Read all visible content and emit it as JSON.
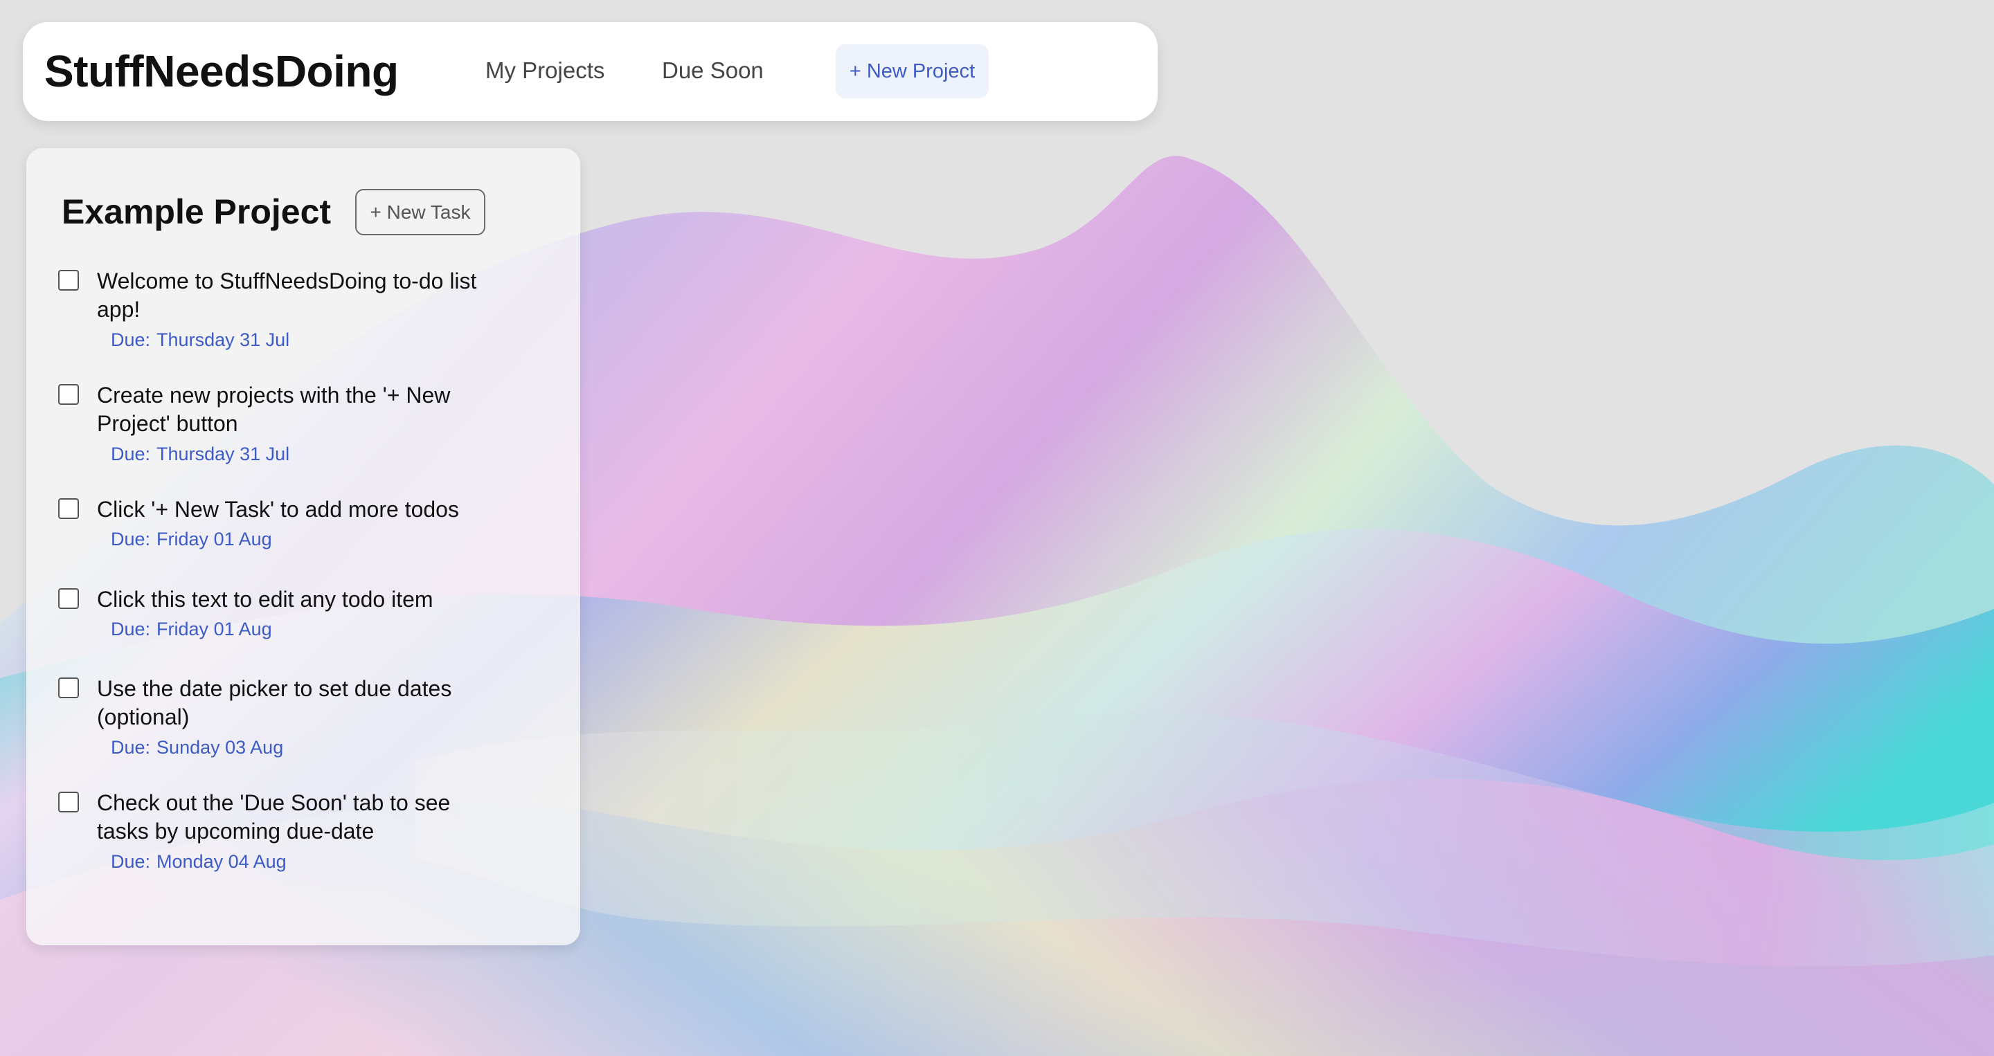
{
  "app": {
    "title": "StuffNeedsDoing"
  },
  "nav": {
    "my_projects": "My Projects",
    "due_soon": "Due Soon",
    "new_project": "+ New Project"
  },
  "project": {
    "title": "Example Project",
    "new_task": "+ New Task",
    "due_label": "Due:",
    "tasks": [
      {
        "text": "Welcome to StuffNeedsDoing to-do list app!",
        "due": "Thursday 31 Jul",
        "checked": false
      },
      {
        "text": "Create new projects with the '+ New Project' button",
        "due": "Thursday 31 Jul",
        "checked": false
      },
      {
        "text": "Click '+ New Task' to add more todos",
        "due": "Friday 01 Aug",
        "checked": false
      },
      {
        "text": "Click this text to edit any todo item",
        "due": "Friday 01 Aug",
        "checked": false
      },
      {
        "text": "Use the date picker to set due dates (optional)",
        "due": "Sunday 03 Aug",
        "checked": false
      },
      {
        "text": "Check out the 'Due Soon' tab to see tasks by upcoming due-date",
        "due": "Monday 04 Aug",
        "checked": false
      }
    ]
  },
  "colors": {
    "background": "#e2e2e2",
    "accent": "#3d5bc4",
    "button_bg": "#eef2fa"
  },
  "background_image": "iridescent-wave-decoration"
}
